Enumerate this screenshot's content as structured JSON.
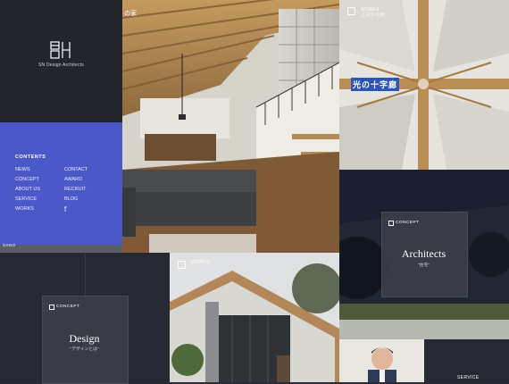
{
  "colors": {
    "menu_bg": "#4a58c8",
    "dark_panel": "#23252d",
    "ribbon": "#2f54b8"
  },
  "logo": {
    "text": "SN Design Architects",
    "icon": "sn-logo-icon"
  },
  "menu": {
    "title": "CONTENTS",
    "left": [
      "NEWS",
      "CONCEPT",
      "ABOUT US",
      "SERVICE",
      "WORKS"
    ],
    "right": [
      "CONTACT",
      "AWARD",
      "RECRUIT",
      "BLOG"
    ],
    "social_icon": "facebook-icon",
    "social_glyph": "f"
  },
  "hero": {
    "partial_title": "の家"
  },
  "works_top": {
    "label": "WORKS",
    "title": "上山手の家",
    "ribbon": "光の十字廊"
  },
  "concept_architects": {
    "label": "CONCEPT",
    "title": "Architects",
    "subtitle": "\"住宅\""
  },
  "concept_design": {
    "label": "CONCEPT",
    "title": "Design",
    "subtitle": "\"デザインとは\""
  },
  "works_bottom": {
    "label": "WORKS",
    "subtitle": "..."
  },
  "sand_label": "SANO",
  "service_label": "SERVICE"
}
